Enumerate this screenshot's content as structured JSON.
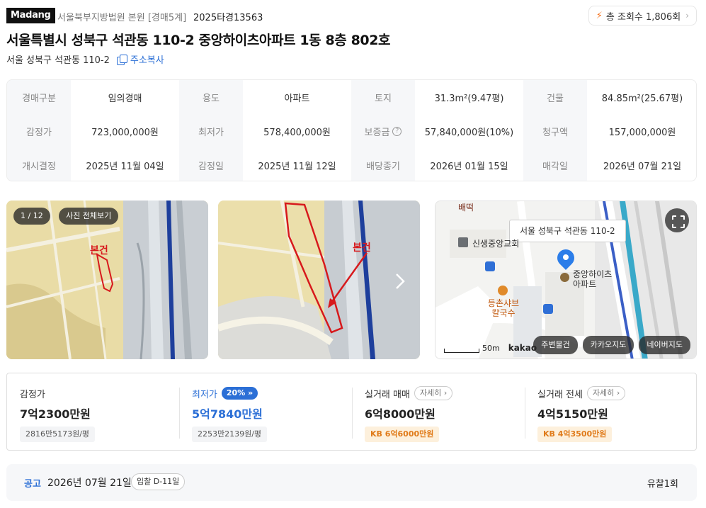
{
  "header": {
    "logo": "Madang",
    "court": "서울북부지방법원 본원 [경매5계]",
    "case_no": "2025타경13563",
    "views_label": "총 조회수 1,806회"
  },
  "title": "서울특별시 성북구 석관동 110-2 중앙하이츠아파트 1동 8층 802호",
  "address": {
    "short": "서울 성북구 석관동 110-2",
    "copy_label": "주소복사"
  },
  "info_grid": [
    [
      {
        "label": "경매구분",
        "value": "임의경매"
      },
      {
        "label": "용도",
        "value": "아파트"
      },
      {
        "label": "토지",
        "value": "31.3m²(9.47평)"
      },
      {
        "label": "건물",
        "value": "84.85m²(25.67평)"
      }
    ],
    [
      {
        "label": "감정가",
        "value": "723,000,000원"
      },
      {
        "label": "최저가",
        "value": "578,400,000원"
      },
      {
        "label": "보증금",
        "value": "57,840,000원(10%)"
      },
      {
        "label": "청구액",
        "value": "157,000,000원"
      }
    ],
    [
      {
        "label": "개시결정",
        "value": "2025년 11월 04일"
      },
      {
        "label": "감정일",
        "value": "2025년 11월 12일"
      },
      {
        "label": "배당종기",
        "value": "2026년 01월 15일"
      },
      {
        "label": "매각일",
        "value": "2026년 07월 21일"
      }
    ]
  ],
  "gallery": {
    "counter": "1 / 12",
    "view_all": "사진 전체보기",
    "marker_text": "본건",
    "map": {
      "address_label": "서울 성북구 석관동 110-2",
      "poi_church": "신생중앙교회",
      "poi_food": "등촌샤브칼국수",
      "poi_apt": "중앙하이츠아파트",
      "poi_top": "배떡",
      "scale": "50m",
      "brand": "kakao",
      "buttons": [
        "주변물건",
        "카카오지도",
        "네이버지도"
      ]
    }
  },
  "summary": {
    "appraisal": {
      "label": "감정가",
      "value": "7억2300만원",
      "sub": "2816만5173원/평"
    },
    "minimum": {
      "label": "최저가",
      "badge": "20%",
      "value": "5억7840만원",
      "sub": "2253만2139원/평"
    },
    "sale": {
      "label": "실거래 매매",
      "detail": "자세히",
      "value": "6억8000만원",
      "kb": "KB 6억6000만원"
    },
    "jeonse": {
      "label": "실거래 전세",
      "detail": "자세히",
      "value": "4억5150만원",
      "kb": "KB 4억3500만원"
    }
  },
  "notice": {
    "tag": "공고",
    "date": "2026년 07월 21일",
    "dday": "입찰 D-11일",
    "result": "유찰1회"
  }
}
